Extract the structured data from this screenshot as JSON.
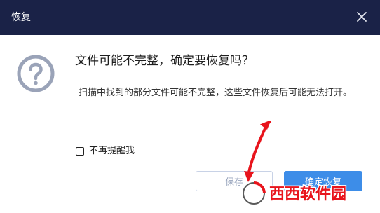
{
  "window": {
    "title": "恢复"
  },
  "dialog": {
    "heading": "文件可能不完整，确定要恢复吗？",
    "description": "扫描中找到的部分文件可能不完整，这些文件恢复后可能无法打开。",
    "dont_remind_label": "不再提醒我",
    "dont_remind_checked": false,
    "save_label": "保存",
    "recover_label": "确定恢复"
  },
  "watermark": {
    "text": "西西软件园"
  },
  "colors": {
    "titlebar": "#1a2247",
    "primary_button": "#3d8de8",
    "icon": "#9aa3b8",
    "annotation_arrow": "#e8141c"
  },
  "icons": {
    "close": "close-icon",
    "dialog": "question-circle-icon"
  }
}
